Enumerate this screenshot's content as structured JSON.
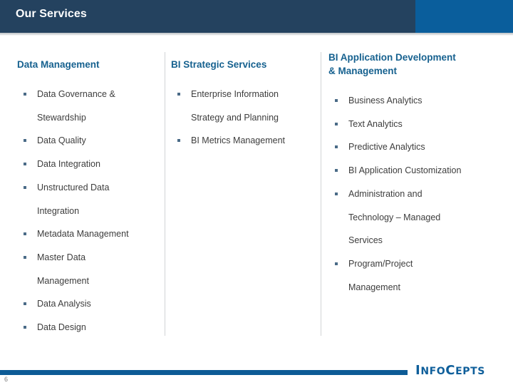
{
  "header": {
    "title": "Our Services",
    "navy_color": "#24425f",
    "blue_color": "#0a5e9c"
  },
  "columns": [
    {
      "heading": "Data Management",
      "items": [
        "Data Governance &\nStewardship",
        "Data Quality",
        "Data Integration",
        "Unstructured Data\nIntegration",
        "Metadata Management",
        "Master Data\nManagement",
        "Data Analysis",
        "Data Design"
      ]
    },
    {
      "heading": "BI Strategic Services",
      "items": [
        "Enterprise Information\nStrategy and Planning",
        "BI Metrics Management"
      ]
    },
    {
      "heading": "BI Application Development\n& Management",
      "items": [
        "Business Analytics",
        "Text Analytics",
        "Predictive Analytics",
        "BI Application Customization",
        "Administration and\nTechnology – Managed\nServices",
        "Program/Project\nManagement"
      ]
    }
  ],
  "footer": {
    "page_number": "6",
    "bar_color": "#0d5b96",
    "logo": {
      "part1_cap": "I",
      "part1_rest": "NFO",
      "part2_cap": "C",
      "part2_rest": "EPTS",
      "color": "#0f5f9b"
    }
  }
}
